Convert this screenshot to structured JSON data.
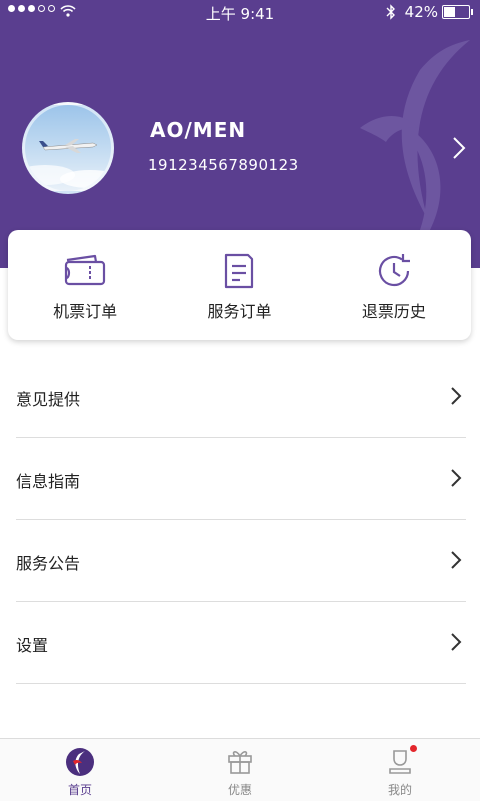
{
  "status_bar": {
    "time": "上午 9:41",
    "battery_percent": "42%",
    "battery_level": 0.42
  },
  "profile": {
    "username": "AO/MEN",
    "phone": "191234567890123"
  },
  "quick_actions": [
    {
      "label": "机票订单",
      "icon": "ticket-icon"
    },
    {
      "label": "服务订单",
      "icon": "document-icon"
    },
    {
      "label": "退票历史",
      "icon": "history-clock-icon"
    }
  ],
  "menu": [
    {
      "label": "意见提供"
    },
    {
      "label": "信息指南"
    },
    {
      "label": "服务公告"
    },
    {
      "label": "设置"
    }
  ],
  "tabbar": [
    {
      "label": "首页",
      "icon": "home-logo-icon",
      "active": true
    },
    {
      "label": "优惠",
      "icon": "gift-icon",
      "active": false
    },
    {
      "label": "我的",
      "icon": "profile-icon",
      "active": false,
      "badge": true
    }
  ],
  "colors": {
    "brand": "#5a3e8f",
    "badge": "#e3262c"
  }
}
